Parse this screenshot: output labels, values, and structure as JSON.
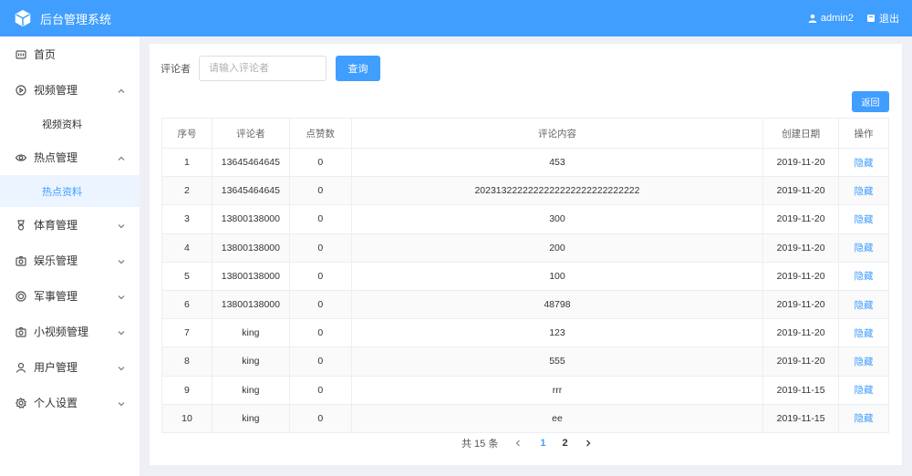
{
  "header": {
    "app_title": "后台管理系统",
    "username": "admin2",
    "logout_label": "退出",
    "accent_color": "#409eff"
  },
  "sidebar": {
    "items": [
      {
        "label": "首页",
        "icon": "home-icon"
      },
      {
        "label": "视频管理",
        "icon": "video-icon",
        "expanded": true,
        "children": [
          "视频资料"
        ]
      },
      {
        "label": "热点管理",
        "icon": "eye-icon",
        "expanded": true,
        "children": [
          "热点资料"
        ],
        "active_child": "热点资料"
      },
      {
        "label": "体育管理",
        "icon": "medal-icon",
        "expanded": false
      },
      {
        "label": "娱乐管理",
        "icon": "camera-icon",
        "expanded": false
      },
      {
        "label": "军事管理",
        "icon": "target-icon",
        "expanded": false
      },
      {
        "label": "小视频管理",
        "icon": "camera-icon",
        "expanded": false
      },
      {
        "label": "用户管理",
        "icon": "user-icon",
        "expanded": false
      },
      {
        "label": "个人设置",
        "icon": "gear-icon",
        "expanded": false
      }
    ]
  },
  "search": {
    "label": "评论者",
    "placeholder": "请输入评论者",
    "value": "",
    "query_label": "查询"
  },
  "back_label": "返回",
  "table": {
    "columns": [
      "序号",
      "评论者",
      "点赞数",
      "评论内容",
      "创建日期",
      "操作"
    ],
    "rows": [
      [
        "1",
        "13645464645",
        "0",
        "453",
        "2019-11-20",
        "隐藏"
      ],
      [
        "2",
        "13645464645",
        "0",
        "2023132222222222222222222222222",
        "2019-11-20",
        "隐藏"
      ],
      [
        "3",
        "13800138000",
        "0",
        "300",
        "2019-11-20",
        "隐藏"
      ],
      [
        "4",
        "13800138000",
        "0",
        "200",
        "2019-11-20",
        "隐藏"
      ],
      [
        "5",
        "13800138000",
        "0",
        "100",
        "2019-11-20",
        "隐藏"
      ],
      [
        "6",
        "13800138000",
        "0",
        "48798",
        "2019-11-20",
        "隐藏"
      ],
      [
        "7",
        "king",
        "0",
        "123",
        "2019-11-20",
        "隐藏"
      ],
      [
        "8",
        "king",
        "0",
        "555",
        "2019-11-20",
        "隐藏"
      ],
      [
        "9",
        "king",
        "0",
        "rrr",
        "2019-11-15",
        "隐藏"
      ],
      [
        "10",
        "king",
        "0",
        "ee",
        "2019-11-15",
        "隐藏"
      ]
    ]
  },
  "pagination": {
    "total_label": "共 15 条",
    "pages": [
      "1",
      "2"
    ],
    "current": "1"
  }
}
